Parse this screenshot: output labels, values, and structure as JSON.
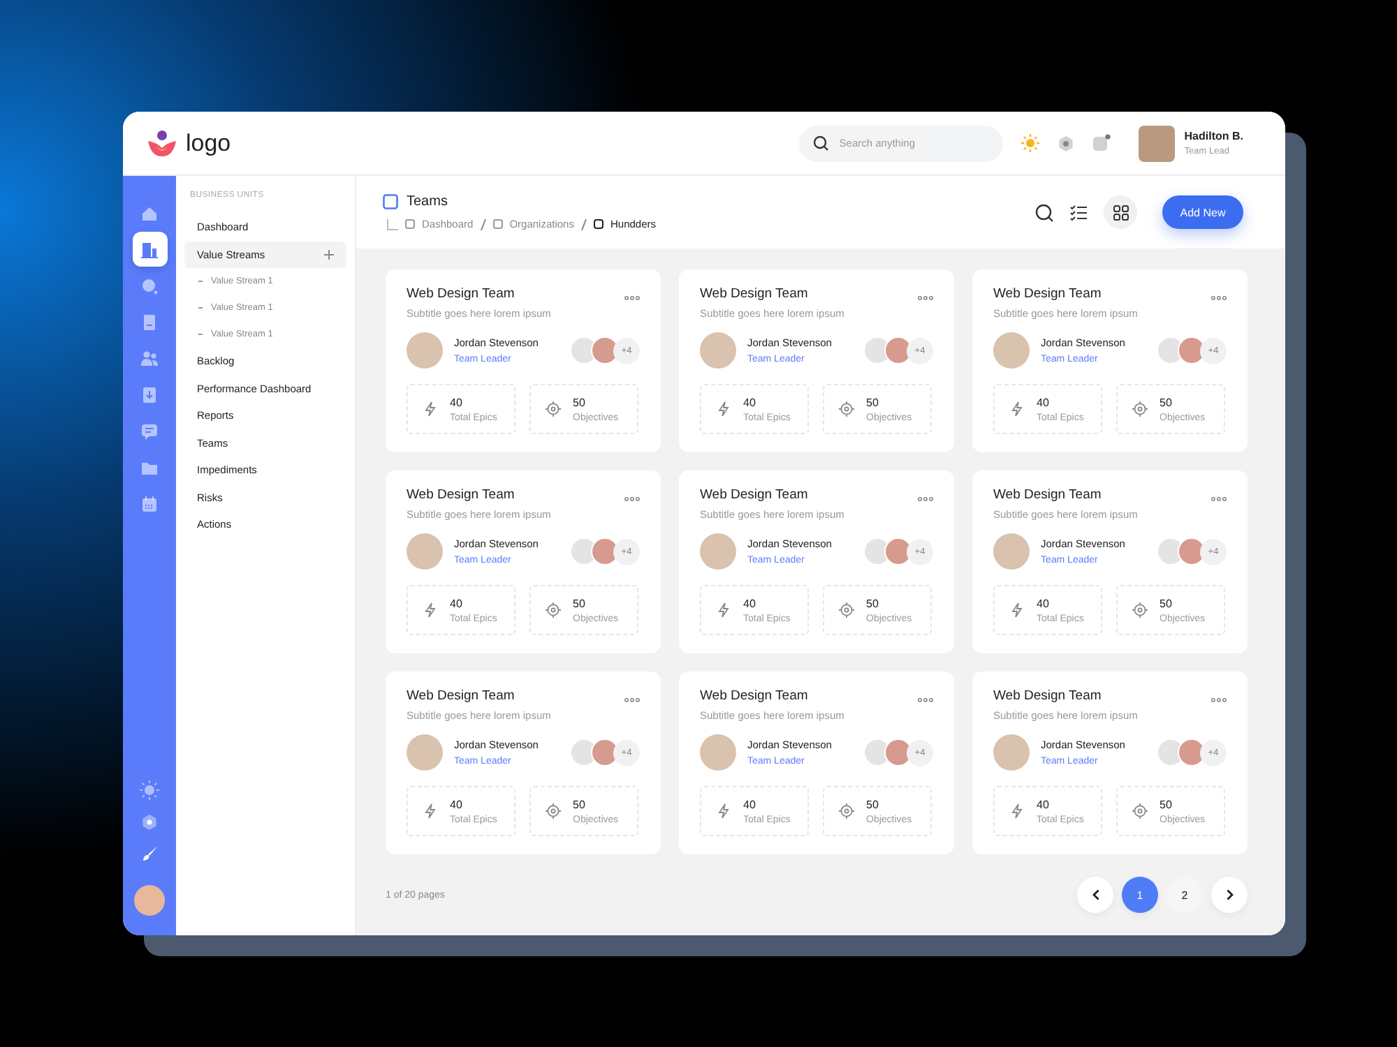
{
  "header": {
    "logo": "logo",
    "search": {
      "placeholder": "Search anything"
    },
    "user": {
      "name": "Hadilton B.",
      "role": "Team Lead"
    }
  },
  "rail": {
    "items": [
      {
        "selected": false
      },
      {
        "selected": true
      },
      {
        "selected": false
      },
      {
        "selected": false
      },
      {
        "selected": false
      },
      {
        "selected": false
      },
      {
        "selected": false
      },
      {
        "selected": false
      },
      {
        "selected": false
      }
    ]
  },
  "nav": {
    "heading": "BUSINESS UNITS",
    "items": [
      {
        "label": "Dashboard",
        "selected": false
      },
      {
        "label": "Value Streams",
        "selected": true,
        "children": [
          {
            "label": "Value Stream 1",
            "selected": false
          },
          {
            "label": "Value Stream 1",
            "selected": false
          },
          {
            "label": "Value Stream 1",
            "selected": false
          }
        ]
      },
      {
        "label": "Backlog",
        "selected": false
      },
      {
        "label": "Performance Dashboard",
        "selected": false
      },
      {
        "label": "Reports",
        "selected": false
      },
      {
        "label": "Teams",
        "selected": false
      },
      {
        "label": "Impediments",
        "selected": false
      },
      {
        "label": "Risks",
        "selected": false
      },
      {
        "label": "Actions",
        "selected": false
      }
    ]
  },
  "page": {
    "title": "Teams",
    "breadcrumb": [
      "Dashboard",
      "Organizations",
      "Hundders"
    ],
    "add_button": "Add New"
  },
  "cards": [
    {
      "title": "Web Design Team",
      "subtitle": "Subtitle goes here lorem ipsum",
      "leader": {
        "name": "Jordan Stevenson",
        "role": "Team Leader"
      },
      "more_members": "+4",
      "stats": [
        {
          "value": "40",
          "label": "Total Epics"
        },
        {
          "value": "50",
          "label": "Objectives"
        }
      ]
    },
    {
      "title": "Web Design Team",
      "subtitle": "Subtitle goes here lorem ipsum",
      "leader": {
        "name": "Jordan Stevenson",
        "role": "Team Leader"
      },
      "more_members": "+4",
      "stats": [
        {
          "value": "40",
          "label": "Total Epics"
        },
        {
          "value": "50",
          "label": "Objectives"
        }
      ]
    },
    {
      "title": "Web Design Team",
      "subtitle": "Subtitle goes here lorem ipsum",
      "leader": {
        "name": "Jordan Stevenson",
        "role": "Team Leader"
      },
      "more_members": "+4",
      "stats": [
        {
          "value": "40",
          "label": "Total Epics"
        },
        {
          "value": "50",
          "label": "Objectives"
        }
      ]
    },
    {
      "title": "Web Design Team",
      "subtitle": "Subtitle goes here lorem ipsum",
      "leader": {
        "name": "Jordan Stevenson",
        "role": "Team Leader"
      },
      "more_members": "+4",
      "stats": [
        {
          "value": "40",
          "label": "Total Epics"
        },
        {
          "value": "50",
          "label": "Objectives"
        }
      ]
    },
    {
      "title": "Web Design Team",
      "subtitle": "Subtitle goes here lorem ipsum",
      "leader": {
        "name": "Jordan Stevenson",
        "role": "Team Leader"
      },
      "more_members": "+4",
      "stats": [
        {
          "value": "40",
          "label": "Total Epics"
        },
        {
          "value": "50",
          "label": "Objectives"
        }
      ]
    },
    {
      "title": "Web Design Team",
      "subtitle": "Subtitle goes here lorem ipsum",
      "leader": {
        "name": "Jordan Stevenson",
        "role": "Team Leader"
      },
      "more_members": "+4",
      "stats": [
        {
          "value": "40",
          "label": "Total Epics"
        },
        {
          "value": "50",
          "label": "Objectives"
        }
      ]
    },
    {
      "title": "Web Design Team",
      "subtitle": "Subtitle goes here lorem ipsum",
      "leader": {
        "name": "Jordan Stevenson",
        "role": "Team Leader"
      },
      "more_members": "+4",
      "stats": [
        {
          "value": "40",
          "label": "Total Epics"
        },
        {
          "value": "50",
          "label": "Objectives"
        }
      ]
    },
    {
      "title": "Web Design Team",
      "subtitle": "Subtitle goes here lorem ipsum",
      "leader": {
        "name": "Jordan Stevenson",
        "role": "Team Leader"
      },
      "more_members": "+4",
      "stats": [
        {
          "value": "40",
          "label": "Total Epics"
        },
        {
          "value": "50",
          "label": "Objectives"
        }
      ]
    },
    {
      "title": "Web Design Team",
      "subtitle": "Subtitle goes here lorem ipsum",
      "leader": {
        "name": "Jordan Stevenson",
        "role": "Team Leader"
      },
      "more_members": "+4",
      "stats": [
        {
          "value": "40",
          "label": "Total Epics"
        },
        {
          "value": "50",
          "label": "Objectives"
        }
      ]
    }
  ],
  "pagination": {
    "summary": "1 of 20 pages",
    "pages": [
      {
        "label": "1",
        "selected": true
      },
      {
        "label": "2",
        "selected": false
      }
    ]
  }
}
